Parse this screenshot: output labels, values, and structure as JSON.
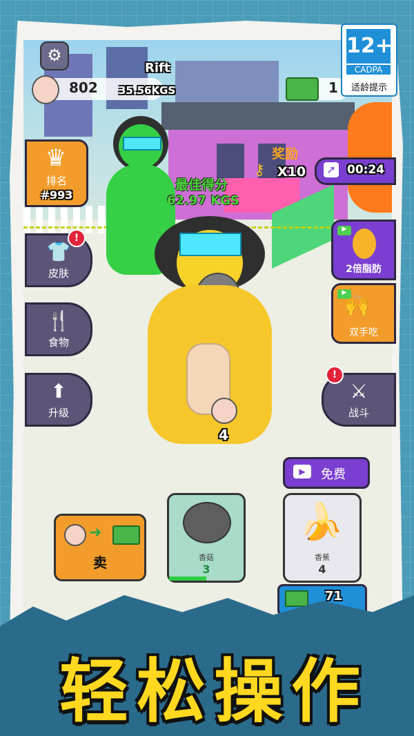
{
  "player": {
    "name": "Rift",
    "fat_count": "802",
    "weight": "35.56KGS",
    "money": "1"
  },
  "age_rating": {
    "rating": "12+",
    "org": "CADPA",
    "note": "适龄提示"
  },
  "rank": {
    "label": "排名",
    "value": "#993"
  },
  "reward": {
    "label": "奖励",
    "multiplier": "X10",
    "timer": "00:24"
  },
  "best_score": {
    "label": "最佳得分",
    "value": "62.97 KGS"
  },
  "left_menu": {
    "skin": "皮肤",
    "food": "食物",
    "upgrade": "升级"
  },
  "right_menu": {
    "double_fat": "2倍脂肪",
    "two_hands": "双手吃",
    "battle": "战斗"
  },
  "badge_mark": "!",
  "bottom": {
    "sell": "卖",
    "mushroom": {
      "name": "香菇",
      "count": "3"
    },
    "banana": {
      "name": "香蕉",
      "count": "4"
    },
    "free": "免费",
    "extra_money": "71"
  },
  "follower_count": "4",
  "slogan": "轻松操作",
  "colors": {
    "accent_orange": "#f29d2b",
    "purple": "#7a3fd0",
    "green_char": "#35d046",
    "yellow_char": "#f7d32a",
    "slogan_yellow": "#ffd81f"
  }
}
